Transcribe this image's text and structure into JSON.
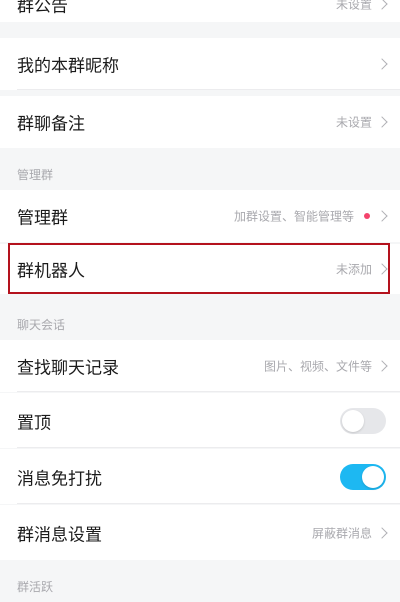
{
  "group_settings": {
    "announcement": {
      "label": "群公告",
      "value": "未设置"
    },
    "my_nickname": {
      "label": "我的本群昵称"
    },
    "remark": {
      "label": "群聊备注",
      "value": "未设置"
    },
    "section_manage": "管理群",
    "manage": {
      "label": "管理群",
      "value": "加群设置、智能管理等"
    },
    "robot": {
      "label": "群机器人",
      "value": "未添加"
    },
    "section_chat": "聊天会话",
    "search_history": {
      "label": "查找聊天记录",
      "value": "图片、视频、文件等"
    },
    "pin_top": {
      "label": "置顶",
      "enabled": false
    },
    "do_not_disturb": {
      "label": "消息免打扰",
      "enabled": true
    },
    "message_settings": {
      "label": "群消息设置",
      "value": "屏蔽群消息"
    },
    "section_active": "群活跃"
  },
  "colors": {
    "toggle_on": "#1db8f2",
    "toggle_off": "#e6e7ea",
    "dot": "#f4436c",
    "highlight": "#b4121d"
  }
}
